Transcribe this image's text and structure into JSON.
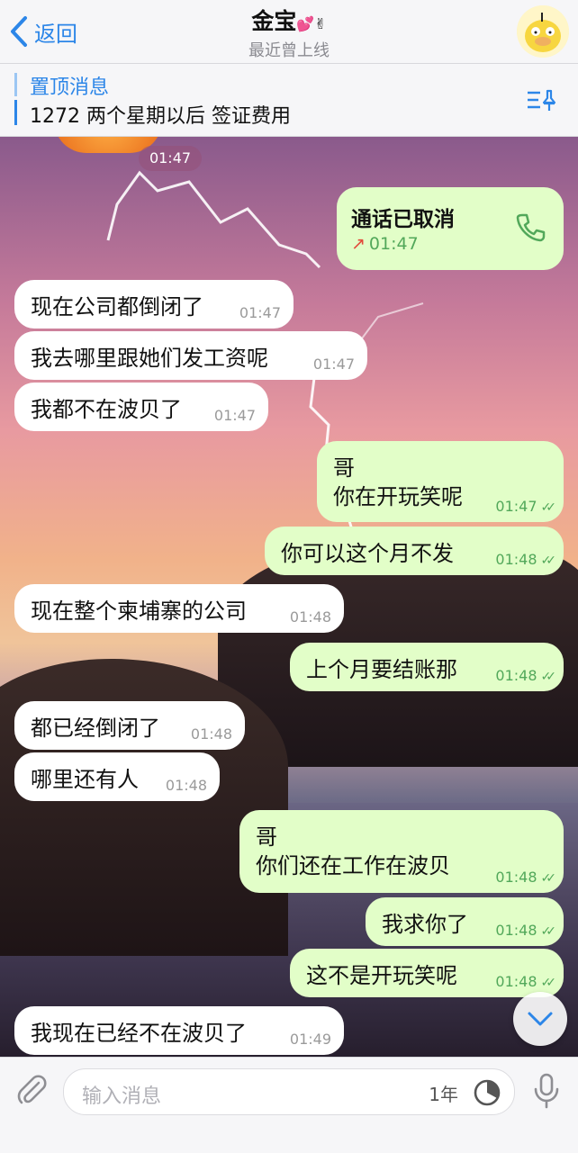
{
  "header": {
    "back_label": "返回",
    "title": "金宝",
    "title_emoji": "💕✌",
    "subtitle": "最近曾上线"
  },
  "pinned": {
    "label": "置顶消息",
    "text": "1272 两个星期以后 签证费用"
  },
  "chat": {
    "top_time": "01:47",
    "call": {
      "title": "通话已取消",
      "time": "01:47"
    },
    "messages": [
      {
        "text": "现在公司都倒闭了",
        "time": "01:47"
      },
      {
        "text": "我去哪里跟她们发工资呢",
        "time": "01:47"
      },
      {
        "text": "我都不在波贝了",
        "time": "01:47"
      },
      {
        "line1": "哥",
        "line2": "你在开玩笑呢",
        "time": "01:47"
      },
      {
        "text": "你可以这个月不发",
        "time": "01:48"
      },
      {
        "text": "现在整个柬埔寨的公司",
        "time": "01:48"
      },
      {
        "text": "上个月要结账那",
        "time": "01:48"
      },
      {
        "text": "都已经倒闭了",
        "time": "01:48"
      },
      {
        "text": "哪里还有人",
        "time": "01:48"
      },
      {
        "line1": "哥",
        "line2": "你们还在工作在波贝",
        "time": "01:48"
      },
      {
        "text": "我求你了",
        "time": "01:48"
      },
      {
        "text": "这不是开玩笑呢",
        "time": "01:48"
      },
      {
        "text": "我现在已经不在波贝了",
        "time": "01:49"
      }
    ]
  },
  "input": {
    "placeholder": "输入消息",
    "timer_label": "1年"
  },
  "colors": {
    "accent": "#2c86e8",
    "outgoing_bubble": "#e2fec8",
    "incoming_bubble": "#ffffff",
    "time_green": "#52a85a"
  }
}
